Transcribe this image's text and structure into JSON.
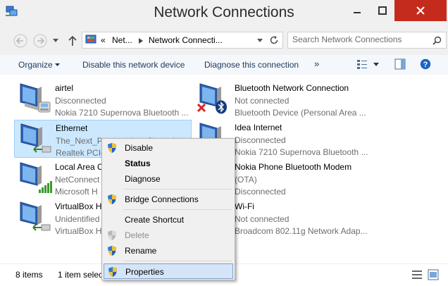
{
  "window": {
    "title": "Network Connections"
  },
  "address": {
    "segments": [
      "«",
      "Net...",
      "Network Connecti..."
    ]
  },
  "search": {
    "placeholder": "Search Network Connections"
  },
  "commands": {
    "organize": "Organize",
    "disable": "Disable this network device",
    "diagnose": "Diagnose this connection",
    "more": "»"
  },
  "connections": [
    {
      "name": "airtel",
      "status": "Disconnected",
      "device": "Nokia 7210 Supernova Bluetooth ..."
    },
    {
      "name": "Bluetooth Network Connection",
      "status": "Not connected",
      "device": "Bluetooth Device (Personal Area ..."
    },
    {
      "name": "Ethernet",
      "status": "The_Next_Permutation_Shared",
      "device": "Realtek PCIe"
    },
    {
      "name": "Idea Internet",
      "status": "Disconnected",
      "device": "Nokia 7210 Supernova Bluetooth ..."
    },
    {
      "name": "Local Area C",
      "status": "NetConnect",
      "device": "Microsoft H"
    },
    {
      "name": "Nokia Phone Bluetooth Modem",
      "status": "(OTA)",
      "device": "Disconnected"
    },
    {
      "name": "VirtualBox H",
      "status": "Unidentified",
      "device": "VirtualBox H"
    },
    {
      "name": "Wi-Fi",
      "status": "Not connected",
      "device": "Broadcom 802.11g Network Adap..."
    }
  ],
  "status_bar": {
    "count": "8 items",
    "selection": "1 item selec"
  },
  "context_menu": {
    "items": [
      {
        "label": "Disable",
        "shield": true
      },
      {
        "label": "Status",
        "bold": true
      },
      {
        "label": "Diagnose"
      },
      {
        "label": "Bridge Connections",
        "shield": true
      },
      {
        "label": "Create Shortcut"
      },
      {
        "label": "Delete",
        "shield": true,
        "disabled": true
      },
      {
        "label": "Rename",
        "shield": true
      },
      {
        "label": "Properties",
        "shield": true,
        "highlighted": true
      }
    ]
  },
  "colors": {
    "close_button": "#c42b1c",
    "selection": "#cce8ff",
    "menu_highlight": "#d5e4f7",
    "link_text": "#1e395b"
  },
  "icons": {
    "network": "network-adapter-icon",
    "shield": "uac-shield-icon",
    "bluetooth": "bluetooth-icon",
    "disconnected": "red-x-icon"
  }
}
